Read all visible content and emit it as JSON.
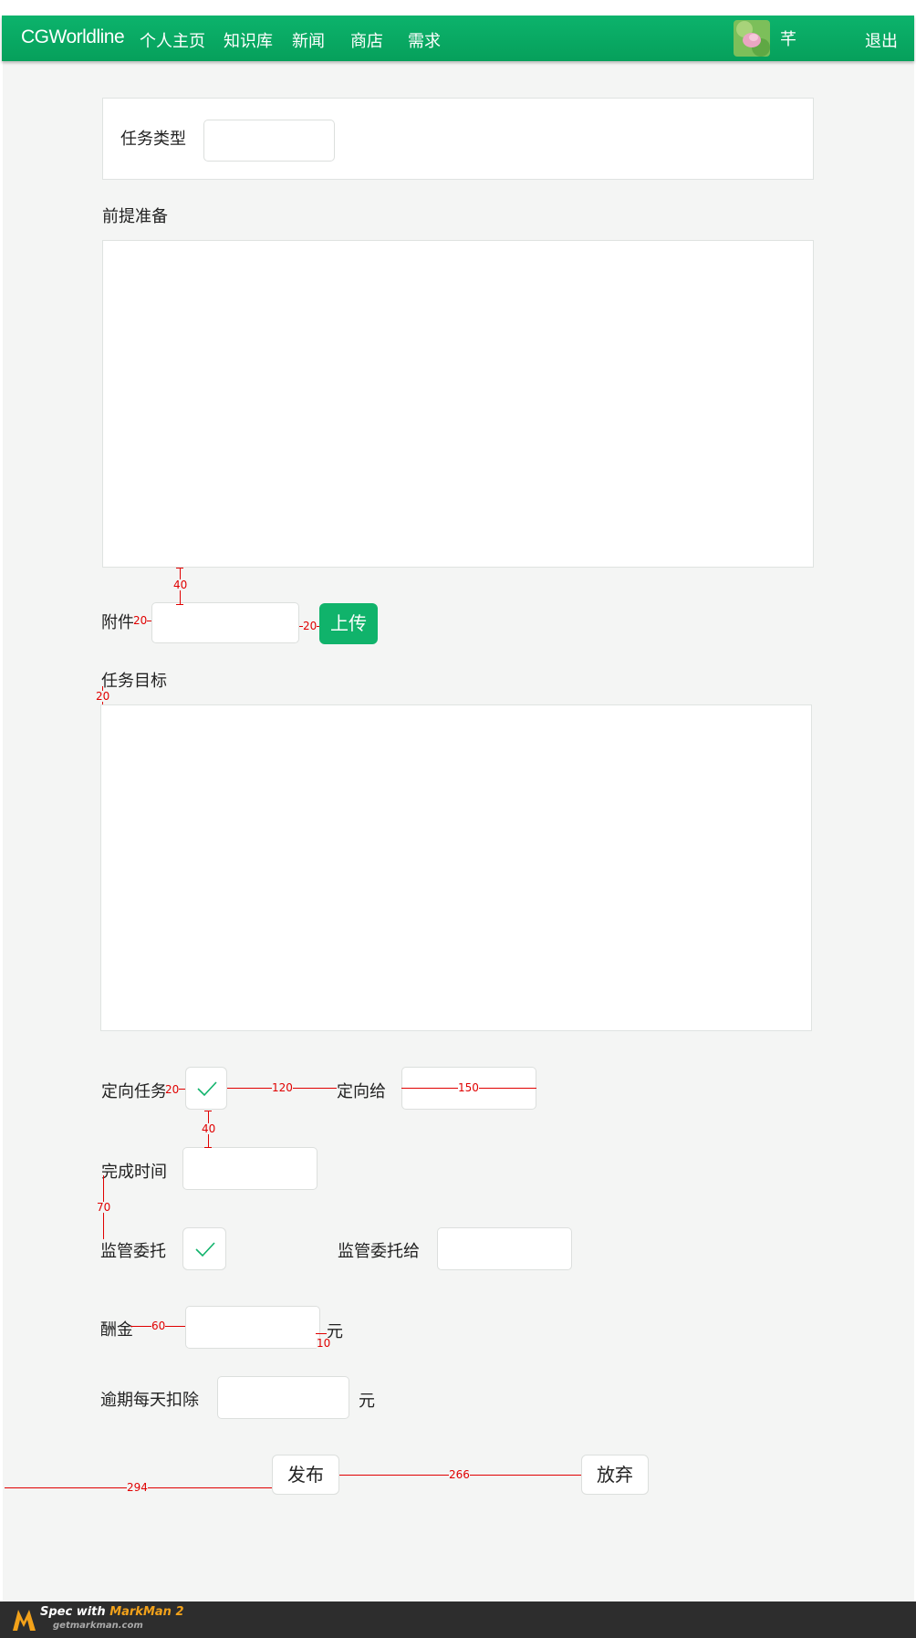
{
  "nav": {
    "logo": "CGWorldline",
    "items": [
      "个人主页",
      "知识库",
      "新闻",
      "商店",
      "需求"
    ],
    "username": "芊",
    "logout": "退出"
  },
  "form": {
    "task_type_label": "任务类型",
    "task_type_value": "",
    "prerequisite_label": "前提准备",
    "prerequisite_value": "",
    "attachment_label": "附件",
    "attachment_value": "",
    "upload_button": "上传",
    "goal_label": "任务目标",
    "goal_value": "",
    "directed_label": "定向任务",
    "directed_checked": true,
    "directed_to_label": "定向给",
    "directed_to_value": "",
    "deadline_label": "完成时间",
    "deadline_value": "",
    "supervise_label": "监管委托",
    "supervise_checked": true,
    "supervise_to_label": "监管委托给",
    "supervise_to_value": "",
    "reward_label": "酬金",
    "reward_value": "",
    "reward_unit": "元",
    "penalty_label": "逾期每天扣除",
    "penalty_value": "",
    "penalty_unit": "元",
    "publish_button": "发布",
    "abandon_button": "放弃"
  },
  "annotations": {
    "a1": "40",
    "a2": "20",
    "a3": "20",
    "a4": "20",
    "a5": "20",
    "a6": "120",
    "a7": "150",
    "a8": "40",
    "a9": "70",
    "a10": "60",
    "a11": "10",
    "a12": "294",
    "a13": "266"
  },
  "footer": {
    "spec_prefix": "Spec with ",
    "brand": "MarkMan 2",
    "url": "getmarkman.com"
  },
  "colors": {
    "accent": "#0cb36c",
    "annotation": "#e00000",
    "check": "#10b36b"
  }
}
